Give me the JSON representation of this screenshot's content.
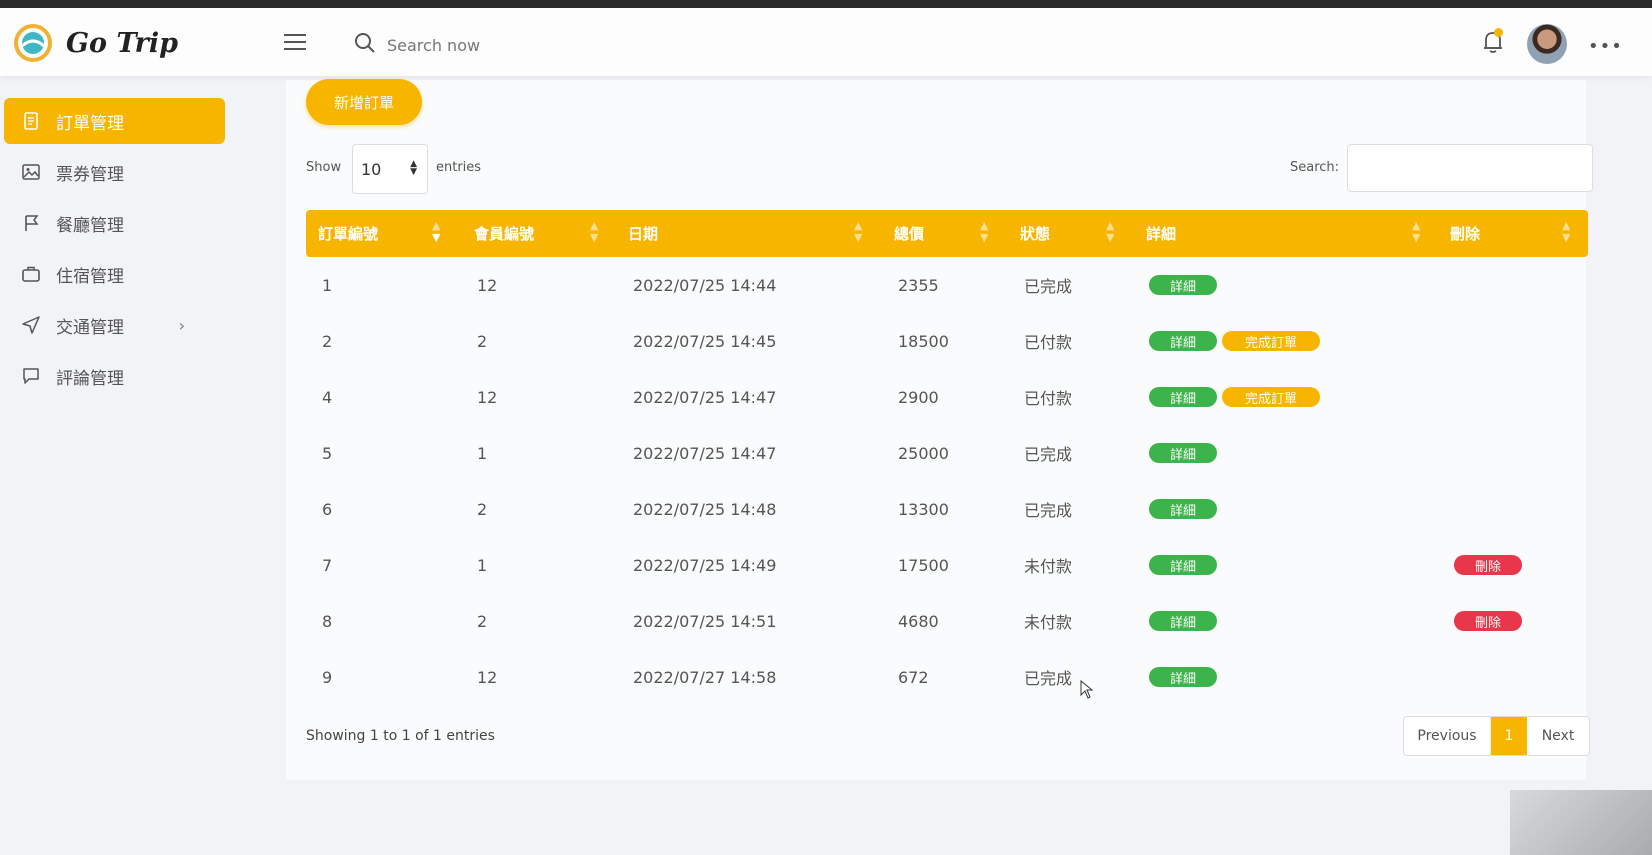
{
  "app": {
    "brand": "Go Trip"
  },
  "topbar": {
    "search_placeholder": "Search now"
  },
  "sidebar": {
    "items": [
      {
        "label": "訂單管理",
        "icon": "document-icon",
        "active": true
      },
      {
        "label": "票券管理",
        "icon": "image-icon",
        "active": false
      },
      {
        "label": "餐廳管理",
        "icon": "flag-icon",
        "active": false
      },
      {
        "label": "住宿管理",
        "icon": "briefcase-icon",
        "active": false
      },
      {
        "label": "交通管理",
        "icon": "navigation-icon",
        "active": false,
        "has_children": true
      },
      {
        "label": "評論管理",
        "icon": "chat-icon",
        "active": false
      }
    ]
  },
  "toolbar": {
    "new_order_label": "新增訂單",
    "show_label": "Show",
    "page_length": "10",
    "entries_label": "entries",
    "search_label": "Search:"
  },
  "table": {
    "columns": [
      "訂單編號",
      "會員編號",
      "日期",
      "總價",
      "狀態",
      "詳細",
      "刪除"
    ],
    "rows": [
      {
        "id": "1",
        "member": "12",
        "date": "2022/07/25 14:44",
        "total": "2355",
        "status": "已完成",
        "detail": "詳細",
        "complete": "",
        "delete": ""
      },
      {
        "id": "2",
        "member": "2",
        "date": "2022/07/25 14:45",
        "total": "18500",
        "status": "已付款",
        "detail": "詳細",
        "complete": "完成訂單",
        "delete": ""
      },
      {
        "id": "4",
        "member": "12",
        "date": "2022/07/25 14:47",
        "total": "2900",
        "status": "已付款",
        "detail": "詳細",
        "complete": "完成訂單",
        "delete": ""
      },
      {
        "id": "5",
        "member": "1",
        "date": "2022/07/25 14:47",
        "total": "25000",
        "status": "已完成",
        "detail": "詳細",
        "complete": "",
        "delete": ""
      },
      {
        "id": "6",
        "member": "2",
        "date": "2022/07/25 14:48",
        "total": "13300",
        "status": "已完成",
        "detail": "詳細",
        "complete": "",
        "delete": ""
      },
      {
        "id": "7",
        "member": "1",
        "date": "2022/07/25 14:49",
        "total": "17500",
        "status": "未付款",
        "detail": "詳細",
        "complete": "",
        "delete": "刪除"
      },
      {
        "id": "8",
        "member": "2",
        "date": "2022/07/25 14:51",
        "total": "4680",
        "status": "未付款",
        "detail": "詳細",
        "complete": "",
        "delete": "刪除"
      },
      {
        "id": "9",
        "member": "12",
        "date": "2022/07/27 14:58",
        "total": "672",
        "status": "已完成",
        "detail": "詳細",
        "complete": "",
        "delete": ""
      }
    ]
  },
  "footer": {
    "info": "Showing 1 to 1 of 1 entries",
    "previous_label": "Previous",
    "current_page": "1",
    "next_label": "Next"
  },
  "colors": {
    "accent": "#f8b500",
    "success": "#3cb44b",
    "danger": "#e8364a"
  }
}
